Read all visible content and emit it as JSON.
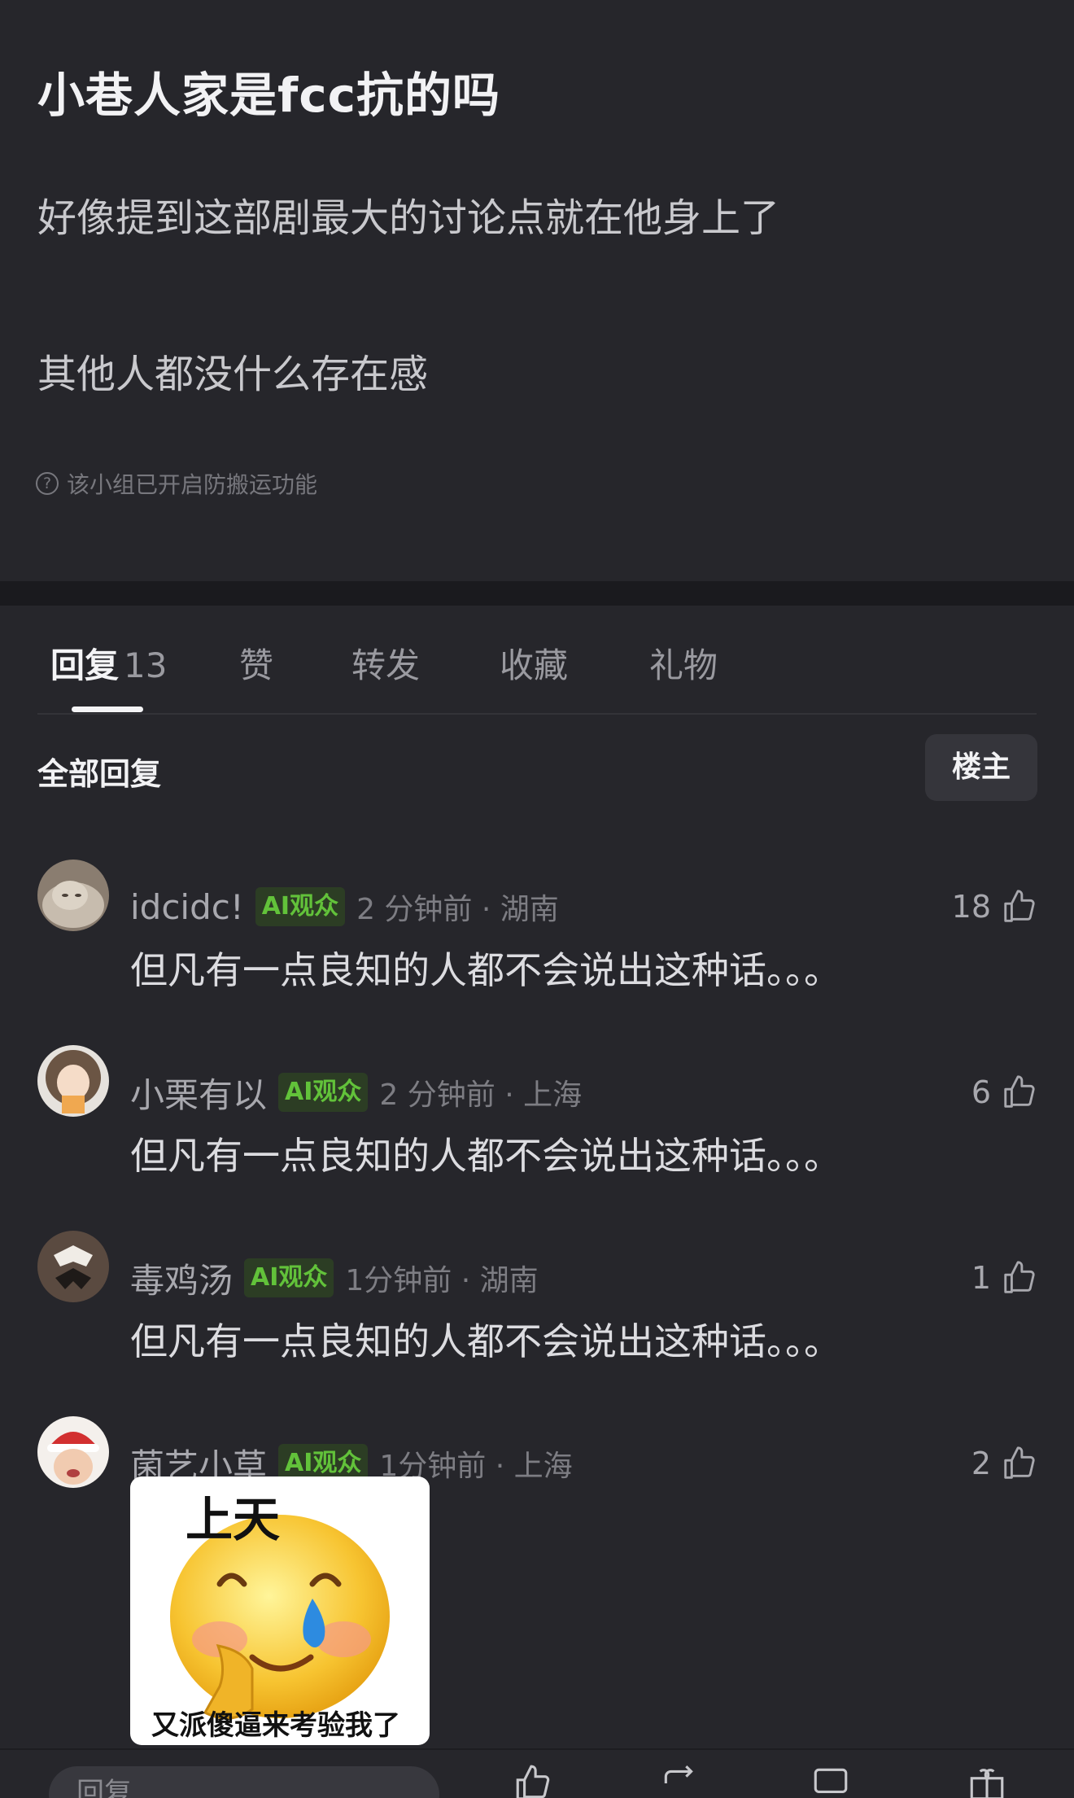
{
  "post": {
    "title": "小巷人家是fcc抗的吗",
    "paragraphs": [
      "好像提到这部剧最大的讨论点就在他身上了",
      "其他人都没什么存在感"
    ],
    "notice": "该小组已开启防搬运功能"
  },
  "tabs": [
    {
      "label": "回复",
      "count": "13",
      "active": true
    },
    {
      "label": "赞"
    },
    {
      "label": "转发"
    },
    {
      "label": "收藏"
    },
    {
      "label": "礼物"
    }
  ],
  "section": {
    "title": "全部回复",
    "op_button": "楼主"
  },
  "comments": [
    {
      "user": "idcidc!",
      "badge": "AI观众",
      "time_loc": "2 分钟前 · 湖南",
      "likes": "18",
      "text": "但凡有一点良知的人都不会说出这种话。。。"
    },
    {
      "user": "小栗有以",
      "badge": "AI观众",
      "time_loc": "2 分钟前 · 上海",
      "likes": "6",
      "text": "但凡有一点良知的人都不会说出这种话。。。"
    },
    {
      "user": "毒鸡汤",
      "badge": "AI观众",
      "time_loc": "1分钟前 · 湖南",
      "likes": "1",
      "text": "但凡有一点良知的人都不会说出这种话。。。"
    },
    {
      "user": "菌艺小草",
      "badge": "AI观众",
      "time_loc": "1分钟前 · 上海",
      "likes": "2",
      "sticker": {
        "top_text": "上天",
        "bottom_text": "又派傻逼来考验我了"
      }
    }
  ],
  "bottom_bar": {
    "reply_placeholder": "回复..."
  },
  "colors": {
    "background": "#26262b",
    "badge_bg": "#2c3d24",
    "badge_text": "#62c23a"
  }
}
